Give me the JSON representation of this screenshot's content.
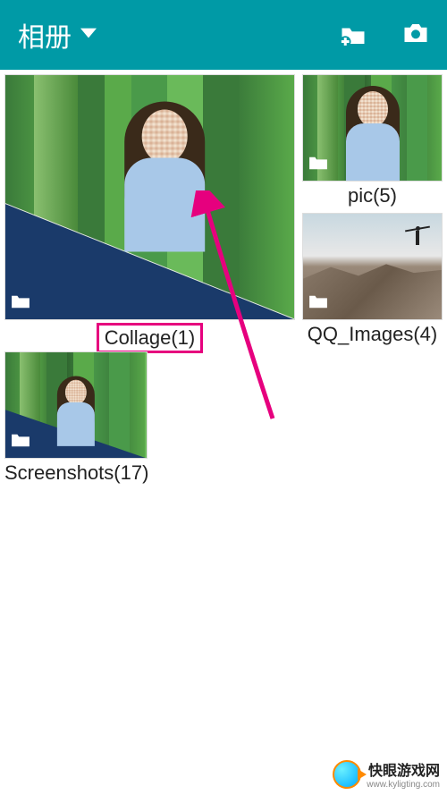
{
  "header": {
    "title": "相册"
  },
  "albums": {
    "collage": {
      "label": "Collage(1)"
    },
    "pic": {
      "label": "pic(5)"
    },
    "qq": {
      "label": "QQ_Images(4)"
    },
    "screenshots": {
      "label": "Screenshots(17)"
    }
  },
  "watermark": {
    "title": "快眼游戏网",
    "url": "www.kyligting.com"
  }
}
